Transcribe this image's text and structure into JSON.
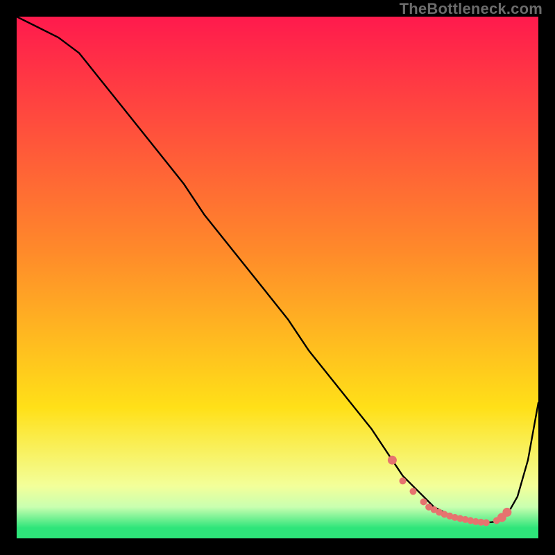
{
  "watermark": "TheBottleneck.com",
  "colors": {
    "bg": "#000000",
    "grad_top": "#ff1a4d",
    "grad_mid1": "#ff6a2a",
    "grad_mid2": "#ffe018",
    "grad_green1": "#d8ffb0",
    "grad_green2": "#2ee57a",
    "curve": "#000000",
    "dots": "#e6736f"
  },
  "chart_data": {
    "type": "line",
    "title": "",
    "xlabel": "",
    "ylabel": "",
    "xlim": [
      0,
      100
    ],
    "ylim": [
      0,
      100
    ],
    "series": [
      {
        "name": "curve",
        "x": [
          0,
          4,
          8,
          12,
          16,
          20,
          24,
          28,
          32,
          36,
          40,
          44,
          48,
          52,
          56,
          60,
          64,
          68,
          72,
          74,
          76,
          78,
          80,
          82,
          84,
          86,
          88,
          90,
          92,
          94,
          96,
          98,
          100
        ],
        "y": [
          100,
          98,
          96,
          93,
          88,
          83,
          78,
          73,
          68,
          62,
          57,
          52,
          47,
          42,
          36,
          31,
          26,
          21,
          15,
          12,
          10,
          8,
          6,
          5,
          4,
          3.5,
          3.2,
          3.0,
          3.2,
          4.5,
          8,
          15,
          26
        ]
      }
    ],
    "highlight_points": {
      "comment": "scatter markers along the trough",
      "x": [
        72,
        74,
        76,
        78,
        79,
        80,
        81,
        82,
        83,
        84,
        85,
        86,
        87,
        88,
        89,
        90,
        92,
        93,
        94
      ],
      "y": [
        15,
        11,
        9,
        7,
        6,
        5.5,
        5,
        4.6,
        4.3,
        4,
        3.8,
        3.6,
        3.4,
        3.2,
        3.1,
        3.0,
        3.4,
        4.0,
        5.0
      ]
    },
    "gradient_bands_y": [
      {
        "y": 100,
        "color": "#ff1a4d"
      },
      {
        "y": 55,
        "color": "#ff8a2a"
      },
      {
        "y": 25,
        "color": "#ffe018"
      },
      {
        "y": 10,
        "color": "#f3ff9a"
      },
      {
        "y": 6,
        "color": "#c9ffb0"
      },
      {
        "y": 2,
        "color": "#2ee57a"
      }
    ]
  }
}
